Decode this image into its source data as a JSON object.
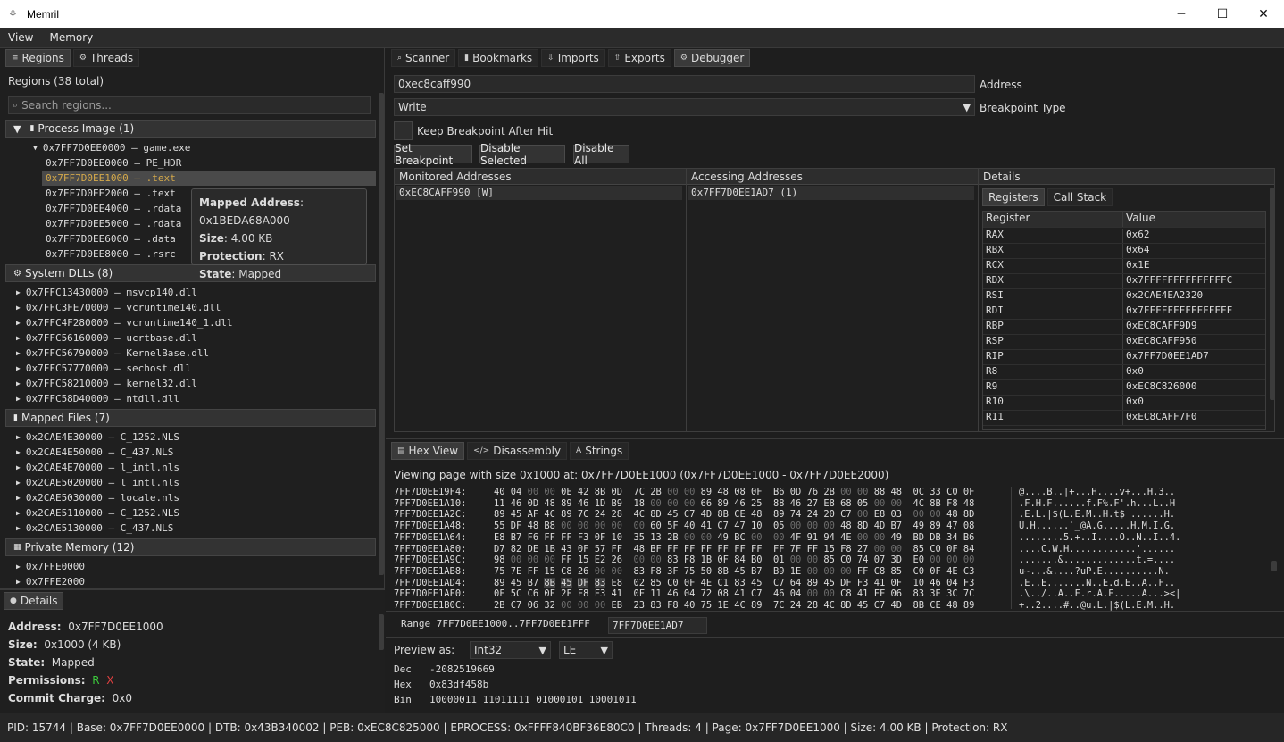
{
  "window": {
    "title": "Memril",
    "minimize": "─",
    "maximize": "☐",
    "close": "✕"
  },
  "menu": [
    "View",
    "Memory"
  ],
  "left_tabs": [
    {
      "label": "Regions",
      "icon": "stack-icon"
    },
    {
      "label": "Threads",
      "icon": "gear-icon"
    }
  ],
  "regions": {
    "count_label": "Regions (38 total)",
    "search_placeholder": "Search regions...",
    "groups": [
      {
        "title": "Process Image (1)",
        "icon": "document-icon"
      },
      {
        "title": "System DLLs (8)",
        "icon": "gear-icon"
      },
      {
        "title": "Mapped Files (7)",
        "icon": "document-icon"
      },
      {
        "title": "Private Memory (12)",
        "icon": "memory-icon"
      }
    ],
    "process_root": "0x7FF7D0EE0000 – game.exe",
    "process_children": [
      "0x7FF7D0EE0000 – PE_HDR",
      "0x7FF7D0EE1000 – .text",
      "0x7FF7D0EE2000 – .text",
      "0x7FF7D0EE4000 – .rdata",
      "0x7FF7D0EE5000 – .rdata",
      "0x7FF7D0EE6000 – .data",
      "0x7FF7D0EE8000 – .rsrc"
    ],
    "dlls": [
      "0x7FFC13430000 – msvcp140.dll",
      "0x7FFC3FE70000 – vcruntime140.dll",
      "0x7FFC4F280000 – vcruntime140_1.dll",
      "0x7FFC56160000 – ucrtbase.dll",
      "0x7FFC56790000 – KernelBase.dll",
      "0x7FFC57770000 – sechost.dll",
      "0x7FFC58210000 – kernel32.dll",
      "0x7FFC58D40000 – ntdll.dll"
    ],
    "mapped": [
      "0x2CAE4E30000 – C_1252.NLS",
      "0x2CAE4E50000 – C_437.NLS",
      "0x2CAE4E70000 – l_intl.nls",
      "0x2CAE5020000 – l_intl.nls",
      "0x2CAE5030000 – locale.nls",
      "0x2CAE5110000 – C_1252.NLS",
      "0x2CAE5130000 – C_437.NLS"
    ],
    "private": [
      "0x7FFE0000",
      "0x7FFE2000"
    ]
  },
  "tooltip": {
    "mapped_k": "Mapped Address",
    "mapped_v": ": 0x1BEDA68A000",
    "size_k": "Size",
    "size_v": ": 4.00 KB",
    "prot_k": "Protection",
    "prot_v": ": RX",
    "state_k": "State",
    "state_v": ": Mapped"
  },
  "details": {
    "tab": "Details",
    "address_k": "Address:",
    "address_v": "0x7FF7D0EE1000",
    "size_k": "Size:",
    "size_v": "0x1000 (4 KB)",
    "state_k": "State:",
    "state_v": "Mapped",
    "perm_k": "Permissions:",
    "perm_r": "R",
    "perm_x": "X",
    "commit_k": "Commit Charge:",
    "commit_v": "0x0"
  },
  "right_tabs": [
    {
      "label": "Scanner",
      "icon": "search-icon"
    },
    {
      "label": "Bookmarks",
      "icon": "bookmark-icon"
    },
    {
      "label": "Imports",
      "icon": "import-icon"
    },
    {
      "label": "Exports",
      "icon": "export-icon"
    },
    {
      "label": "Debugger",
      "icon": "gear-icon"
    }
  ],
  "debugger": {
    "address_value": "0xec8caff990",
    "address_label": "Address",
    "bp_type_value": "Write",
    "bp_type_label": "Breakpoint Type",
    "keep_label": "Keep Breakpoint After Hit",
    "buttons": [
      "Set Breakpoint",
      "Disable Selected",
      "Disable All"
    ],
    "monitored_header": "Monitored Addresses",
    "monitored": [
      "0xEC8CAFF990 [W]"
    ],
    "accessing_header": "Accessing Addresses",
    "accessing": [
      "0x7FF7D0EE1AD7 (1)"
    ],
    "details_header": "Details",
    "detail_tabs": [
      "Registers",
      "Call Stack"
    ],
    "reg_col": "Register",
    "val_col": "Value",
    "registers": [
      [
        "RAX",
        "0x62"
      ],
      [
        "RBX",
        "0x64"
      ],
      [
        "RCX",
        "0x1E"
      ],
      [
        "RDX",
        "0x7FFFFFFFFFFFFFFC"
      ],
      [
        "RSI",
        "0x2CAE4EA2320"
      ],
      [
        "RDI",
        "0x7FFFFFFFFFFFFFFF"
      ],
      [
        "RBP",
        "0xEC8CAFF9D9"
      ],
      [
        "RSP",
        "0xEC8CAFF950"
      ],
      [
        "RIP",
        "0x7FF7D0EE1AD7"
      ],
      [
        "R8",
        "0x0"
      ],
      [
        "R9",
        "0xEC8C826000"
      ],
      [
        "R10",
        "0x0"
      ],
      [
        "R11",
        "0xEC8CAFF7F0"
      ]
    ]
  },
  "bottom_tabs": [
    {
      "label": "Hex View",
      "icon": "hex-icon"
    },
    {
      "label": "Disassembly",
      "icon": "code-icon"
    },
    {
      "label": "Strings",
      "icon": "text-icon"
    }
  ],
  "hex": {
    "viewing": "Viewing page with size 0x1000 at: 0x7FF7D0EE1000   (0x7FF7D0EE1000 - 0x7FF7D0EE2000)",
    "rows": [
      [
        "7FF7D0EE19F4:",
        "40 04 00 00 0E 42 8B 0D 7C 2B 00 00 89 48 08 0F B6 0D 76 2B 00 00 88 48 0C 33 C0 0F",
        "@....B..|+...H....v+...H.3.."
      ],
      [
        "7FF7D0EE1A10:",
        "11 46 0D 48 89 46 1D B9 18 00 00 00 66 89 46 25 88 46 27 E8 68 05 00 00 4C 8B F8 48",
        ".F.H.F......f.F%.F'.h...L..H"
      ],
      [
        "7FF7D0EE1A2C:",
        "89 45 AF 4C 89 7C 24 28 4C 8D 45 C7 4D 8B CE 48 89 74 24 20 C7 00 E8 03 00 00 48 8D",
        ".E.L.|$(L.E.M..H.t$ ......H."
      ],
      [
        "7FF7D0EE1A48:",
        "55 DF 48 B8 00 00 00 00 00 60 5F 40 41 C7 47 10 05 00 00 00 48 8D 4D B7 49 89 47 08",
        "U.H......`_@A.G.....H.M.I.G."
      ],
      [
        "7FF7D0EE1A64:",
        "E8 B7 F6 FF FF F3 0F 10 35 13 2B 00 00 49 BC 00 00 4F 91 94 4E 00 00 49 BD DB 34 B6",
        "........5.+..I....O..N..I..4."
      ],
      [
        "7FF7D0EE1A80:",
        "D7 82 DE 1B 43 0F 57 FF 48 BF FF FF FF FF FF FF FF 7F FF 15 F8 27 00 00 85 C0 0F 84",
        "....C.W.H............'......"
      ],
      [
        "7FF7D0EE1A9C:",
        "98 00 00 00 FF 15 E2 26 00 00 83 F8 1B 0F 84 B0 01 00 00 85 C0 74 07 3D E0 00 00 00",
        ".......&.............t.=...."
      ],
      [
        "7FF7D0EE1AB8:",
        "75 7E FF 15 C8 26 00 00 83 F8 3F 75 50 8B 45 B7 B9 1E 00 00 00 FF C8 85 C0 0F 4E C3",
        "u~...&....?uP.E..........N."
      ],
      [
        "7FF7D0EE1AD4:",
        "89 45 B7 8B 45 DF 83 E8 02 85 C0 0F 4E C1 83 45 C7 64 89 45 DF F3 41 0F 10 46 04 F3",
        ".E..E.......N..E.d.E..A..F.."
      ],
      [
        "7FF7D0EE1AF0:",
        "0F 5C C6 0F 2F F8 F3 41 0F 11 46 04 72 08 41 C7 46 04 00 00 C8 41 FF 06 83 3E 3C 7C",
        ".\\../..A..F.r.A.F.....A...><|"
      ],
      [
        "7FF7D0EE1B0C:",
        "2B C7 06 32 00 00 00 EB 23 83 F8 40 75 1E 4C 89 7C 24 28 4C 8D 45 C7 4D 8B CE 48 89",
        "+..2....#..@u.L.|$(L.E.M..H."
      ]
    ],
    "range_label": "Range 7FF7D0EE1000..7FF7D0EE1FFF",
    "range_value": "7FF7D0EE1AD7",
    "preview_label": "Preview as:",
    "preview_type": "Int32",
    "endian": "LE",
    "dec_k": "Dec",
    "dec_v": "-2082519669",
    "hex_k": "Hex",
    "hex_v": "0x83df458b",
    "bin_k": "Bin",
    "bin_v": "10000011 11011111 01000101 10001011"
  },
  "status": "PID: 15744 | Base: 0x7FF7D0EE0000 | DTB: 0x43B340002 | PEB: 0xEC8C825000 | EPROCESS: 0xFFFF840BF36E80C0 | Threads: 4   |   Page: 0x7FF7D0EE1000 | Size: 4.00 KB | Protection: RX",
  "colors": {
    "accent_selected": "#4a4a4a",
    "perm_read": "#3cc83c",
    "perm_exec": "#e04040",
    "highlight_addr": "#d4a94a"
  }
}
